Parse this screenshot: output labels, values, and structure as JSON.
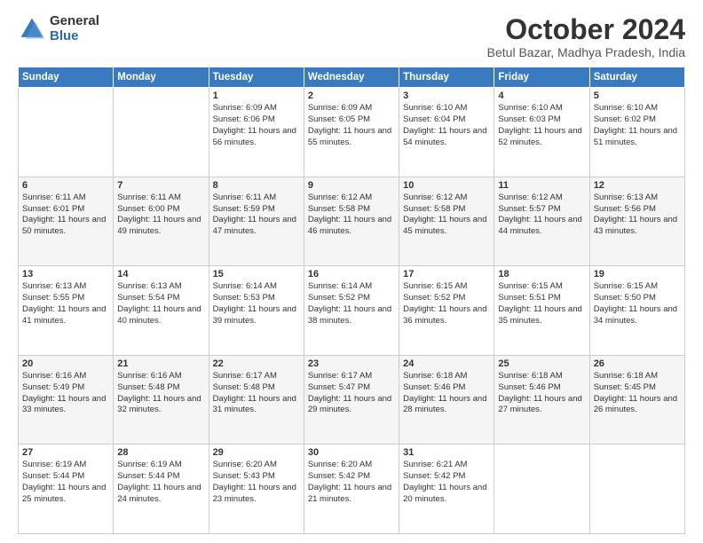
{
  "header": {
    "logo": {
      "general": "General",
      "blue": "Blue"
    },
    "title": "October 2024",
    "location": "Betul Bazar, Madhya Pradesh, India"
  },
  "days_of_week": [
    "Sunday",
    "Monday",
    "Tuesday",
    "Wednesday",
    "Thursday",
    "Friday",
    "Saturday"
  ],
  "weeks": [
    [
      {
        "day": "",
        "content": ""
      },
      {
        "day": "",
        "content": ""
      },
      {
        "day": "1",
        "sunrise": "6:09 AM",
        "sunset": "6:06 PM",
        "daylight": "11 hours and 56 minutes."
      },
      {
        "day": "2",
        "sunrise": "6:09 AM",
        "sunset": "6:05 PM",
        "daylight": "11 hours and 55 minutes."
      },
      {
        "day": "3",
        "sunrise": "6:10 AM",
        "sunset": "6:04 PM",
        "daylight": "11 hours and 54 minutes."
      },
      {
        "day": "4",
        "sunrise": "6:10 AM",
        "sunset": "6:03 PM",
        "daylight": "11 hours and 52 minutes."
      },
      {
        "day": "5",
        "sunrise": "6:10 AM",
        "sunset": "6:02 PM",
        "daylight": "11 hours and 51 minutes."
      }
    ],
    [
      {
        "day": "6",
        "sunrise": "6:11 AM",
        "sunset": "6:01 PM",
        "daylight": "11 hours and 50 minutes."
      },
      {
        "day": "7",
        "sunrise": "6:11 AM",
        "sunset": "6:00 PM",
        "daylight": "11 hours and 49 minutes."
      },
      {
        "day": "8",
        "sunrise": "6:11 AM",
        "sunset": "5:59 PM",
        "daylight": "11 hours and 47 minutes."
      },
      {
        "day": "9",
        "sunrise": "6:12 AM",
        "sunset": "5:58 PM",
        "daylight": "11 hours and 46 minutes."
      },
      {
        "day": "10",
        "sunrise": "6:12 AM",
        "sunset": "5:58 PM",
        "daylight": "11 hours and 45 minutes."
      },
      {
        "day": "11",
        "sunrise": "6:12 AM",
        "sunset": "5:57 PM",
        "daylight": "11 hours and 44 minutes."
      },
      {
        "day": "12",
        "sunrise": "6:13 AM",
        "sunset": "5:56 PM",
        "daylight": "11 hours and 43 minutes."
      }
    ],
    [
      {
        "day": "13",
        "sunrise": "6:13 AM",
        "sunset": "5:55 PM",
        "daylight": "11 hours and 41 minutes."
      },
      {
        "day": "14",
        "sunrise": "6:13 AM",
        "sunset": "5:54 PM",
        "daylight": "11 hours and 40 minutes."
      },
      {
        "day": "15",
        "sunrise": "6:14 AM",
        "sunset": "5:53 PM",
        "daylight": "11 hours and 39 minutes."
      },
      {
        "day": "16",
        "sunrise": "6:14 AM",
        "sunset": "5:52 PM",
        "daylight": "11 hours and 38 minutes."
      },
      {
        "day": "17",
        "sunrise": "6:15 AM",
        "sunset": "5:52 PM",
        "daylight": "11 hours and 36 minutes."
      },
      {
        "day": "18",
        "sunrise": "6:15 AM",
        "sunset": "5:51 PM",
        "daylight": "11 hours and 35 minutes."
      },
      {
        "day": "19",
        "sunrise": "6:15 AM",
        "sunset": "5:50 PM",
        "daylight": "11 hours and 34 minutes."
      }
    ],
    [
      {
        "day": "20",
        "sunrise": "6:16 AM",
        "sunset": "5:49 PM",
        "daylight": "11 hours and 33 minutes."
      },
      {
        "day": "21",
        "sunrise": "6:16 AM",
        "sunset": "5:48 PM",
        "daylight": "11 hours and 32 minutes."
      },
      {
        "day": "22",
        "sunrise": "6:17 AM",
        "sunset": "5:48 PM",
        "daylight": "11 hours and 31 minutes."
      },
      {
        "day": "23",
        "sunrise": "6:17 AM",
        "sunset": "5:47 PM",
        "daylight": "11 hours and 29 minutes."
      },
      {
        "day": "24",
        "sunrise": "6:18 AM",
        "sunset": "5:46 PM",
        "daylight": "11 hours and 28 minutes."
      },
      {
        "day": "25",
        "sunrise": "6:18 AM",
        "sunset": "5:46 PM",
        "daylight": "11 hours and 27 minutes."
      },
      {
        "day": "26",
        "sunrise": "6:18 AM",
        "sunset": "5:45 PM",
        "daylight": "11 hours and 26 minutes."
      }
    ],
    [
      {
        "day": "27",
        "sunrise": "6:19 AM",
        "sunset": "5:44 PM",
        "daylight": "11 hours and 25 minutes."
      },
      {
        "day": "28",
        "sunrise": "6:19 AM",
        "sunset": "5:44 PM",
        "daylight": "11 hours and 24 minutes."
      },
      {
        "day": "29",
        "sunrise": "6:20 AM",
        "sunset": "5:43 PM",
        "daylight": "11 hours and 23 minutes."
      },
      {
        "day": "30",
        "sunrise": "6:20 AM",
        "sunset": "5:42 PM",
        "daylight": "11 hours and 21 minutes."
      },
      {
        "day": "31",
        "sunrise": "6:21 AM",
        "sunset": "5:42 PM",
        "daylight": "11 hours and 20 minutes."
      },
      {
        "day": "",
        "content": ""
      },
      {
        "day": "",
        "content": ""
      }
    ]
  ]
}
